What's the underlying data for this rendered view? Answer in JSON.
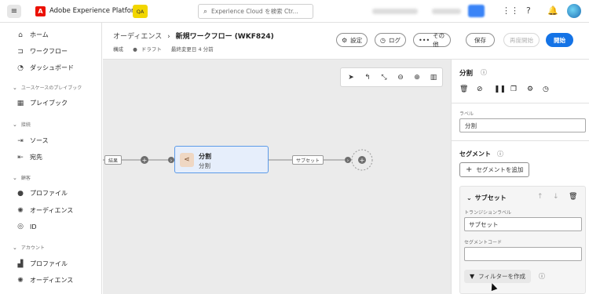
{
  "topbar": {
    "app_title": "Adobe Experience Platform",
    "qa_badge": "QA",
    "search_placeholder": "Experience Cloud を検索 Ctr..."
  },
  "sidebar": {
    "items": [
      {
        "label": "ホーム",
        "icon": "home-icon"
      },
      {
        "label": "ワークフロー",
        "icon": "workflow-icon"
      },
      {
        "label": "ダッシュボード",
        "icon": "dashboard-icon"
      }
    ],
    "sections": [
      {
        "label": "ユースケースのプレイブック",
        "items": [
          {
            "label": "プレイブック",
            "icon": "playbook-icon"
          }
        ]
      },
      {
        "label": "接続",
        "items": [
          {
            "label": "ソース",
            "icon": "sources-icon"
          },
          {
            "label": "宛先",
            "icon": "destinations-icon"
          }
        ]
      },
      {
        "label": "顧客",
        "items": [
          {
            "label": "プロファイル",
            "icon": "profile-icon"
          },
          {
            "label": "オーディエンス",
            "icon": "audience-icon"
          },
          {
            "label": "ID",
            "icon": "identity-icon"
          }
        ]
      },
      {
        "label": "アカウント",
        "items": [
          {
            "label": "プロファイル",
            "icon": "account-profile-icon"
          },
          {
            "label": "オーディエンス",
            "icon": "account-audience-icon"
          }
        ]
      }
    ]
  },
  "header": {
    "breadcrumb_parent": "オーディエンス",
    "breadcrumb_sep": "›",
    "title": "新規ワークフロー (WKF824)",
    "meta_tab": "構成",
    "meta_status": "ドラフト",
    "meta_modified": "最終変更日 4 分前",
    "settings_label": "設定",
    "log_label": "ログ",
    "more_label": "その他",
    "save_label": "保存",
    "restart_label": "再度開始",
    "start_label": "開始"
  },
  "canvas": {
    "edge_in_label": "結果",
    "node_title": "分割",
    "node_subtitle": "分割",
    "edge_out_label": "サブセット"
  },
  "panel": {
    "title": "分割",
    "label_caption": "ラベル",
    "label_value": "分割",
    "segments_title": "セグメント",
    "add_segment_label": "セグメントを追加",
    "subset": {
      "title": "サブセット",
      "transition_label_caption": "トランジションラベル",
      "transition_label_value": "サブセット",
      "segment_code_caption": "セグメントコード",
      "segment_code_value": "",
      "filter_button_label": "フィルターを作成"
    }
  },
  "colors": {
    "accent": "#1473e6",
    "brand_red": "#eb1000",
    "qa_yellow": "#f2d600",
    "node_fill": "#e6eefb",
    "node_border": "#5b9ae8",
    "canvas_bg": "#ebebeb"
  }
}
